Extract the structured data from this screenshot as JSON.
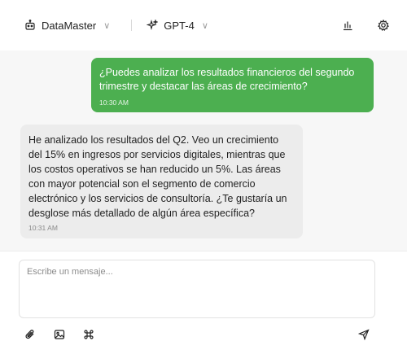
{
  "header": {
    "app_name": "DataMaster",
    "app_icon": "robot-icon",
    "model_name": "GPT-4",
    "model_icon": "sparkle-icon",
    "chevron": "∨",
    "stats_icon": "bar-chart-icon",
    "settings_icon": "gear-icon"
  },
  "messages": [
    {
      "role": "user",
      "text": "¿Puedes analizar los resultados financieros del segundo trimestre y destacar las áreas de crecimiento?",
      "time": "10:30 AM"
    },
    {
      "role": "assistant",
      "text": "He analizado los resultados del Q2. Veo un crecimiento del 15% en ingresos por servicios digitales, mientras que los costos operativos se han reducido un 5%. Las áreas con mayor potencial son el segmento de comercio electrónico y los servicios de consultoría. ¿Te gustaría un desglose más detallado de algún área específica?",
      "time": "10:31 AM"
    }
  ],
  "composer": {
    "placeholder": "Escribe un mensaje...",
    "attach_icon": "paperclip-icon",
    "image_icon": "image-icon",
    "command_icon": "command-icon",
    "send_icon": "send-icon"
  },
  "colors": {
    "user_bubble": "#4caf50",
    "assistant_bubble": "#ececec",
    "chat_background": "#f7f7f7"
  }
}
